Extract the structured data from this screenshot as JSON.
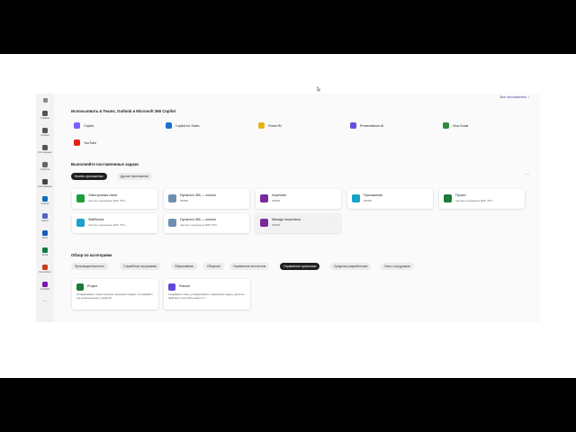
{
  "rail": {
    "items": [
      {
        "label": "",
        "icon": "waffle-icon"
      },
      {
        "label": "Главная",
        "icon": "home-icon"
      },
      {
        "label": "Создать",
        "icon": "create-icon"
      },
      {
        "label": "Мои данные",
        "icon": "my-content-icon"
      },
      {
        "label": "OneDrive",
        "icon": "onedrive-icon"
      },
      {
        "label": "Приложения",
        "icon": "apps-icon"
      },
      {
        "label": "Outlook",
        "icon": "outlook-icon"
      },
      {
        "label": "Teams",
        "icon": "teams-icon"
      },
      {
        "label": "Word",
        "icon": "word-icon"
      },
      {
        "label": "Excel",
        "icon": "excel-icon"
      },
      {
        "label": "PowerPoint",
        "icon": "powerpoint-icon"
      },
      {
        "label": "OneNote",
        "icon": "onenote-icon"
      },
      {
        "label": "",
        "icon": "more-icon"
      }
    ]
  },
  "header": {
    "all_apps": "Все приложения",
    "all_apps_chevron": "›"
  },
  "section1": {
    "title": "Использовать в Teams, Outlook и Microsoft 365 Copilot",
    "apps": [
      {
        "label": "Copilot",
        "color": "#7b61ff"
      },
      {
        "label": "Copilot for Sales",
        "color": "#1a73c9"
      },
      {
        "label": "Power BI",
        "color": "#e8b21d"
      },
      {
        "label": "Presentations AI",
        "color": "#6a4de0"
      },
      {
        "label": "Viva Goals",
        "color": "#2e8b3c"
      },
      {
        "label": "YouTube",
        "color": "#e62117"
      }
    ]
  },
  "section2": {
    "title": "Выполняйте поставленные задачи",
    "tabs": [
      "Бизнес-приложения",
      "Другие приложения"
    ],
    "cards": [
      {
        "title": "Электронные книги",
        "sub": "Частное учреждение ДПО \"РГК...",
        "color": "#1a9e3a"
      },
      {
        "title": "Dynamics 365 — custom",
        "sub": "DM365",
        "color": "#6e8fb0"
      },
      {
        "title": "Inspection",
        "sub": "DM365",
        "color": "#7a2a9a"
      },
      {
        "title": "Приложения",
        "sub": "DM365",
        "color": "#1aa3c9"
      },
      {
        "title": "Проект",
        "sub": "Частное учреждение ДПО \"РГК...",
        "color": "#1e7a3c"
      },
      {
        "title": "StaffWorks",
        "sub": "Частное учреждение ДПО \"РГК...",
        "color": "#1aa3c9"
      },
      {
        "title": "Dynamics 365 — custom",
        "sub": "Частное учреждение ДПО \"РГК...",
        "color": "#6e8fb0"
      },
      {
        "title": "Manage Inspections",
        "sub": "DM365",
        "color": "#7a2a9a"
      }
    ],
    "more": "...",
    "card_more": "..."
  },
  "section3": {
    "title": "Обзор по категориям",
    "categories": [
      "Производительность",
      "Служебные программы",
      "Образование",
      "Общение",
      "Управление контентом",
      "Управление проектами",
      "Средства разработчика",
      "Опыт сотрудников"
    ],
    "active_category": "Управление проектами",
    "cards": [
      {
        "title": "Project",
        "desc": "Устанавливайте планы проектов, назначайте задачи, отслеживайте ход их выполнения и управляй...",
        "color": "#1e7a3c"
      },
      {
        "title": "Planner",
        "desc": "Создавайте планы, упорядочивайте и назначайте задачи, делитесь файлами и получайте новости о ...",
        "color": "#5b4bd6"
      }
    ]
  }
}
